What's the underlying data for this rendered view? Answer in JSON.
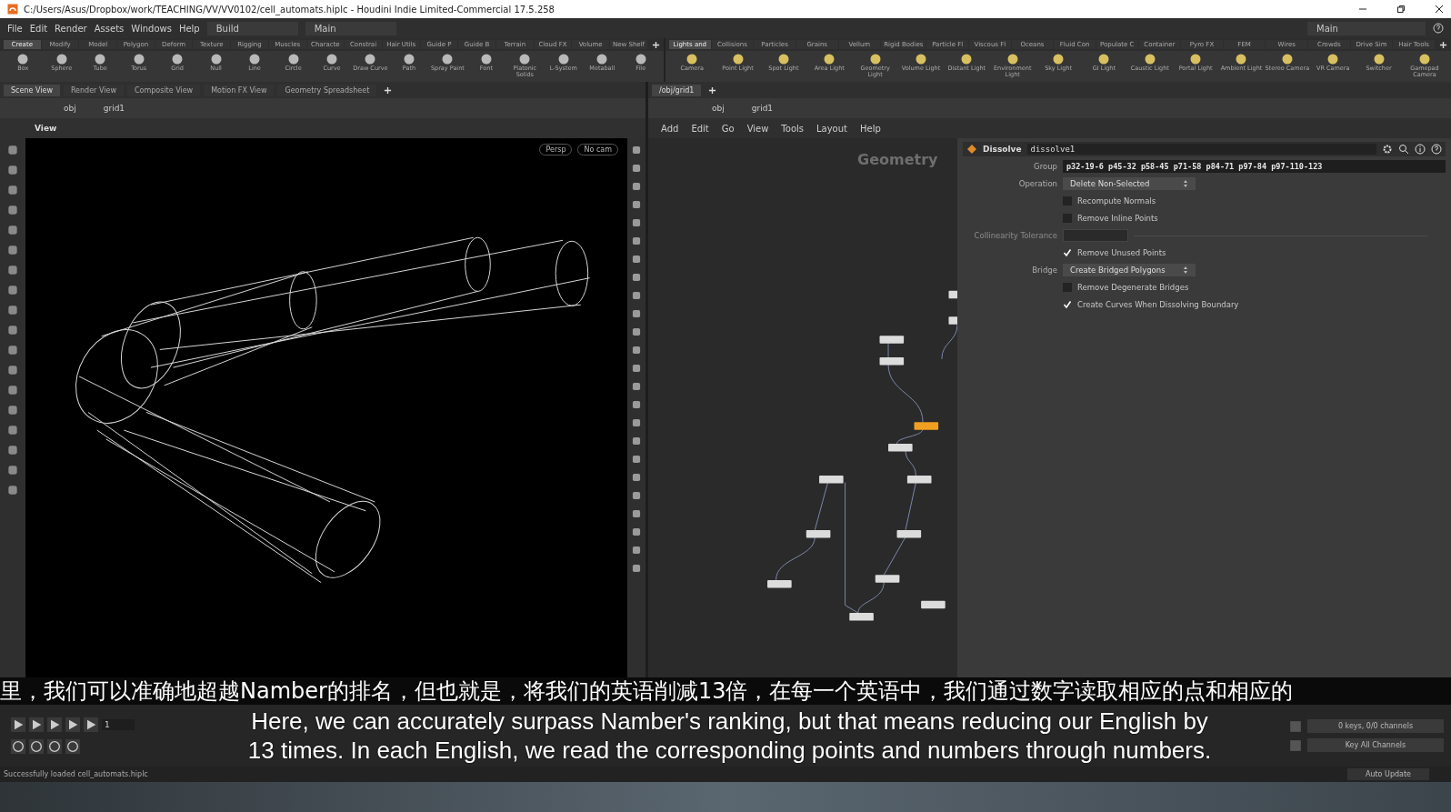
{
  "window": {
    "title": "C:/Users/Asus/Dropbox/work/TEACHING/VV/VV0102/cell_automats.hiplc - Houdini Indie Limited-Commercial 17.5.258"
  },
  "menu": [
    "File",
    "Edit",
    "Render",
    "Assets",
    "Windows",
    "Help"
  ],
  "desktops": [
    {
      "label": "Build"
    },
    {
      "label": "Main"
    }
  ],
  "right_desktop": "Main",
  "shelves": [
    {
      "tabs": [
        {
          "label": "Create",
          "selected": true
        },
        {
          "label": "Modify",
          "selected": false
        },
        {
          "label": "Model",
          "selected": false
        },
        {
          "label": "Polygon",
          "selected": false
        },
        {
          "label": "Deform",
          "selected": false
        },
        {
          "label": "Texture",
          "selected": false
        },
        {
          "label": "Rigging",
          "selected": false
        },
        {
          "label": "Muscles",
          "selected": false
        },
        {
          "label": "Characte",
          "selected": false
        },
        {
          "label": "Constrai",
          "selected": false
        },
        {
          "label": "Hair Utils",
          "selected": false
        },
        {
          "label": "Guide P",
          "selected": false
        },
        {
          "label": "Guide B",
          "selected": false
        },
        {
          "label": "Terrain",
          "selected": false
        },
        {
          "label": "Cloud FX",
          "selected": false
        },
        {
          "label": "Volume",
          "selected": false
        },
        {
          "label": "New Shelf",
          "selected": false
        }
      ],
      "tools": [
        "Box",
        "Sphere",
        "Tube",
        "Torus",
        "Grid",
        "Null",
        "Line",
        "Circle",
        "Curve",
        "Draw Curve",
        "Path",
        "Spray Paint",
        "Font",
        "Platonic Solids",
        "L-System",
        "Metaball",
        "File"
      ]
    },
    {
      "tabs": [
        {
          "label": "Lights and",
          "selected": true
        },
        {
          "label": "Collisions",
          "selected": false
        },
        {
          "label": "Particles",
          "selected": false
        },
        {
          "label": "Grains",
          "selected": false
        },
        {
          "label": "Vellum",
          "selected": false
        },
        {
          "label": "Rigid Bodies",
          "selected": false
        },
        {
          "label": "Particle Fl",
          "selected": false
        },
        {
          "label": "Viscous Fl",
          "selected": false
        },
        {
          "label": "Oceans",
          "selected": false
        },
        {
          "label": "Fluid Con",
          "selected": false
        },
        {
          "label": "Populate C",
          "selected": false
        },
        {
          "label": "Container",
          "selected": false
        },
        {
          "label": "Pyro FX",
          "selected": false
        },
        {
          "label": "FEM",
          "selected": false
        },
        {
          "label": "Wires",
          "selected": false
        },
        {
          "label": "Crowds",
          "selected": false
        },
        {
          "label": "Drive Sim",
          "selected": false
        },
        {
          "label": "Hair Tools",
          "selected": false
        }
      ],
      "tools": [
        "Camera",
        "Point Light",
        "Spot Light",
        "Area Light",
        "Geometry Light",
        "Volume Light",
        "Distant Light",
        "Environment Light",
        "Sky Light",
        "GI Light",
        "Caustic Light",
        "Portal Light",
        "Ambient Light",
        "Stereo Camera",
        "VR Camera",
        "Switcher",
        "Gamepad Camera"
      ]
    }
  ],
  "left_pane": {
    "tabs": [
      {
        "label": "Scene View",
        "selected": true
      },
      {
        "label": "Render View",
        "selected": false
      },
      {
        "label": "Composite View",
        "selected": false
      },
      {
        "label": "Motion FX View",
        "selected": false
      },
      {
        "label": "Geometry Spreadsheet",
        "selected": false
      }
    ],
    "path": [
      "obj",
      "grid1"
    ],
    "view_label": "View",
    "viewport_menus": [
      "Persp",
      "No cam"
    ]
  },
  "right_pane": {
    "tabs": [
      {
        "label": "/obj/grid1",
        "selected": true
      }
    ],
    "path": [
      "obj",
      "grid1"
    ],
    "menu": [
      "Add",
      "Edit",
      "Go",
      "View",
      "Tools",
      "Layout",
      "Help"
    ],
    "network_labels": [
      "Geometry"
    ],
    "parameters": {
      "node_type": "Dissolve",
      "node_name": "dissolve1",
      "rows": [
        {
          "kind": "field",
          "label": "Group",
          "value": "p32-19-6 p45-32 p58-45 p71-58 p84-71 p97-84 p97-110-123"
        },
        {
          "kind": "menu",
          "label": "Operation",
          "value": "Delete Non-Selected"
        },
        {
          "kind": "checkbox",
          "label": "Recompute Normals",
          "checked": false
        },
        {
          "kind": "checkbox",
          "label": "Remove Inline Points",
          "checked": false
        },
        {
          "kind": "slider",
          "label": "Collinearity Tolerance",
          "disabled": true
        },
        {
          "kind": "checkbox",
          "label": "Remove Unused Points",
          "checked": true
        },
        {
          "kind": "menu",
          "label": "Bridge",
          "value": "Create Bridged Polygons"
        },
        {
          "kind": "checkbox",
          "label": "Remove Degenerate Bridges",
          "checked": false
        },
        {
          "kind": "checkbox",
          "label": "Create Curves When Dissolving Boundary",
          "checked": true
        }
      ]
    }
  },
  "subtitles": {
    "chinese": "里，我们可以准确地超越Namber的排名，但也就是，将我们的英语削减13倍，在每一个英语中，我们通过数字读取相应的点和相应的",
    "english": [
      "Here, we can accurately surpass Namber's ranking, but that means reducing our English by",
      "13 times. In each English, we read the corresponding points and numbers through numbers."
    ]
  },
  "playbar": {
    "frame": "1",
    "keys": "0 keys, 0/0 channels",
    "key_all": "Key All Channels",
    "auto_update": "Auto Update"
  },
  "status_bar": "Successfully loaded cell_automats.hiplc"
}
